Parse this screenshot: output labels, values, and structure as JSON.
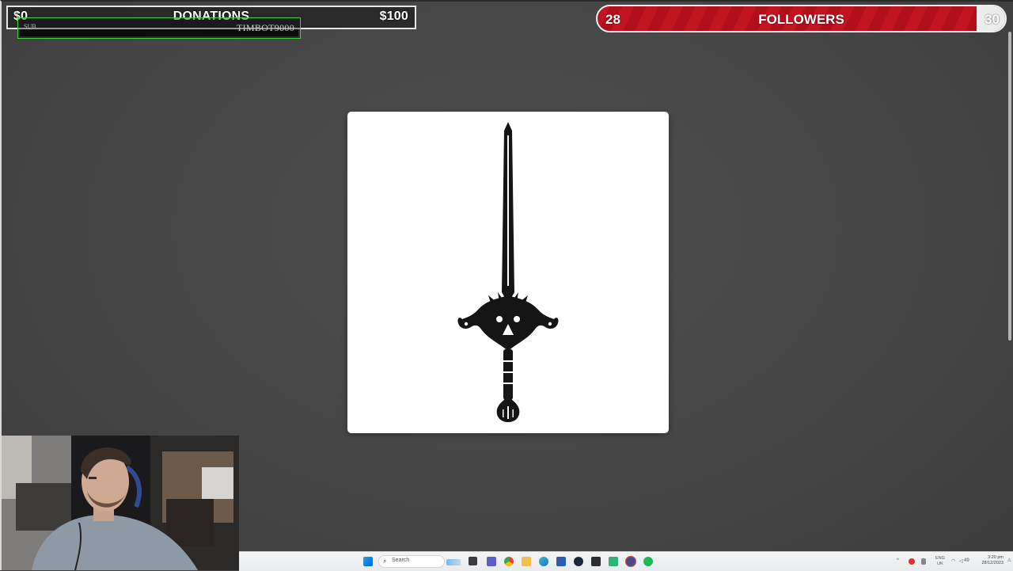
{
  "donations": {
    "min_label": "$0",
    "title": "DONATIONS",
    "max_label": "$100"
  },
  "sub_alert": {
    "type_label": "SUB",
    "username": "TIMBOT9000"
  },
  "followers": {
    "current": "28",
    "title": "FOLLOWERS",
    "goal": "30",
    "progress_fraction": 0.93,
    "bar_color": "#c21522"
  },
  "card": {
    "image": "sword-emblem"
  },
  "taskbar": {
    "search_placeholder": "Search",
    "language": "ENG",
    "region": "UK",
    "volume": "49",
    "time": "3:20 pm",
    "date": "28/12/2023",
    "icons": [
      "windows-start-icon",
      "search-icon",
      "task-view-icon",
      "file-explorer-icon",
      "teams-icon",
      "chrome-icon",
      "folder-icon",
      "edge-icon",
      "store-icon",
      "steam-icon",
      "notepad-icon",
      "app-green-icon",
      "obs-icon",
      "spotify-icon"
    ]
  }
}
